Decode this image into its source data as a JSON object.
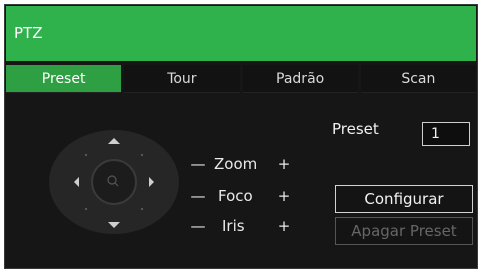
{
  "window": {
    "title": "PTZ"
  },
  "tabs": [
    {
      "label": "Preset",
      "active": true
    },
    {
      "label": "Tour",
      "active": false
    },
    {
      "label": "Padrão",
      "active": false
    },
    {
      "label": "Scan",
      "active": false
    }
  ],
  "controls": {
    "zoom": {
      "minus": "—",
      "label": "Zoom",
      "plus": "+"
    },
    "focus": {
      "minus": "—",
      "label": "Foco",
      "plus": "+"
    },
    "iris": {
      "minus": "—",
      "label": "Iris",
      "plus": "+"
    }
  },
  "preset": {
    "label": "Preset",
    "value": "1",
    "configure_label": "Configurar",
    "delete_label": "Apagar Preset"
  },
  "colors": {
    "accent": "#2fb24c",
    "tab_active": "#2f9f44",
    "panel_bg": "#161616"
  },
  "icons": {
    "pan_up": "chevron-up-icon",
    "pan_down": "chevron-down-icon",
    "pan_left": "chevron-left-icon",
    "pan_right": "chevron-right-icon",
    "center": "magnifier-icon"
  }
}
